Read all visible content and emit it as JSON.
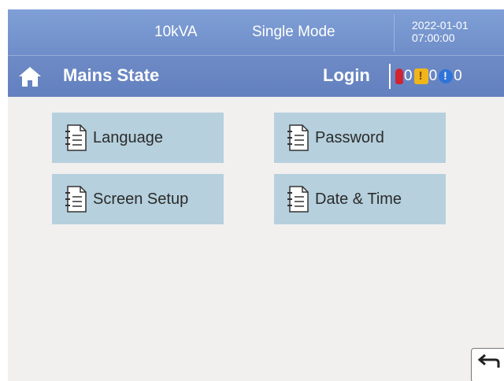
{
  "topbar": {
    "rating": "10kVA",
    "mode": "Single Mode",
    "date": "2022-01-01",
    "time": "07:00:00"
  },
  "statusbar": {
    "state": "Mains State",
    "login": "Login",
    "alarms": {
      "critical_count": "0",
      "warning_count": "0",
      "info_count": "0"
    }
  },
  "menu": {
    "language": "Language",
    "password": "Password",
    "screen_setup": "Screen Setup",
    "date_time": "Date & Time"
  },
  "colors": {
    "header": "#7f9fd6",
    "status": "#6e8bc6",
    "button": "#b6d0dd",
    "background": "#f1f0ef"
  },
  "icons": {
    "home": "home-icon",
    "menu_items": "document-list-icon",
    "back": "back-arrow-icon"
  }
}
